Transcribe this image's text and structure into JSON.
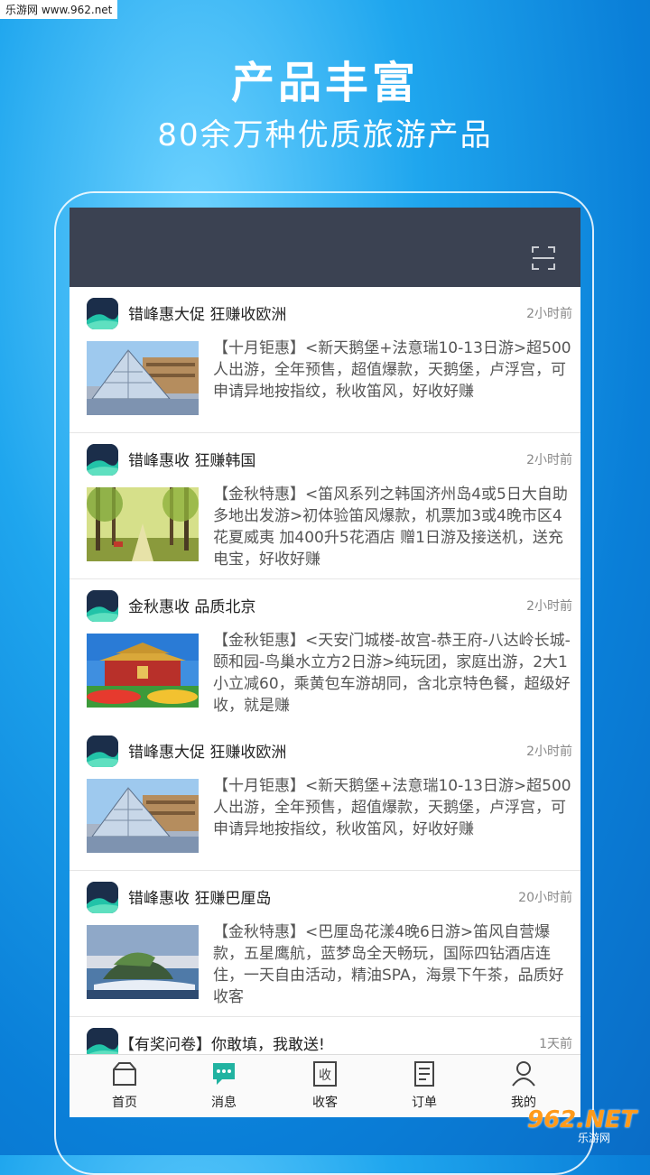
{
  "watermark_top": "乐游网 www.962.net",
  "promo": {
    "title": "产品丰富",
    "subtitle": "80余万种优质旅游产品"
  },
  "feed": [
    {
      "title": "错峰惠大促 狂赚收欧洲",
      "time": "2小时前",
      "desc": "【十月钜惠】<新天鹅堡+法意瑞10-13日游>超500人出游，全年预售，超值爆款，天鹅堡，卢浮宫，可申请异地按指纹，秋收笛风，好收好赚",
      "image": "louvre-pyramid"
    },
    {
      "title": "错峰惠收 狂赚韩国",
      "time": "2小时前",
      "desc": "【金秋特惠】<笛风系列之韩国济州岛4或5日大自助 多地出发游>初体验笛风爆款，机票加3或4晚市区4花夏威夷 加400升5花酒店 赠1日游及接送机，送充电宝，好收好赚",
      "image": "autumn-forest"
    },
    {
      "title": "金秋惠收  品质北京",
      "time": "2小时前",
      "desc": "【金秋钜惠】<天安门城楼-故宫-恭王府-八达岭长城-颐和园-鸟巢水立方2日游>纯玩团，家庭出游，2大1小立减60，乘黄包车游胡同，含北京特色餐，超级好收，就是赚",
      "image": "tiananmen"
    },
    {
      "title": "错峰惠大促 狂赚收欧洲",
      "time": "2小时前",
      "desc": "【十月钜惠】<新天鹅堡+法意瑞10-13日游>超500人出游，全年预售，超值爆款，天鹅堡，卢浮宫，可申请异地按指纹，秋收笛风，好收好赚",
      "image": "louvre-pyramid"
    },
    {
      "title": "错峰惠收 狂赚巴厘岛",
      "time": "20小时前",
      "desc": "【金秋特惠】<巴厘岛花漾4晚6日游>笛风自营爆款，五星鹰航，蓝梦岛全天畅玩，国际四钻酒店连住，一天自由活动，精油SPA，海景下午茶，品质好收客",
      "image": "bali-temple"
    },
    {
      "title": "【有奖问卷】你敢填，我敢送!",
      "time": "1天前",
      "desc": "",
      "image": ""
    }
  ],
  "tabs": [
    {
      "label": "首页",
      "icon": "home-icon"
    },
    {
      "label": "消息",
      "icon": "message-icon"
    },
    {
      "label": "收客",
      "icon": "collect-icon"
    },
    {
      "label": "订单",
      "icon": "order-icon"
    },
    {
      "label": "我的",
      "icon": "profile-icon"
    }
  ],
  "colors": {
    "topbar": "#3b4252",
    "accent": "#21b3a1",
    "background": "#1fa6ee"
  },
  "watermark_bottom": {
    "big": "962.NET",
    "small": "乐游网"
  }
}
